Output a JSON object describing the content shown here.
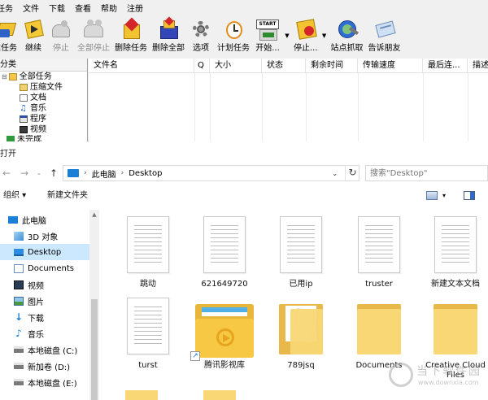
{
  "download_manager": {
    "menu": [
      "任务",
      "文件",
      "下载",
      "查看",
      "帮助",
      "注册"
    ],
    "toolbar": [
      {
        "id": "new",
        "label": "建任务",
        "icon": "new-task-icon",
        "enabled": true
      },
      {
        "id": "resume",
        "label": "继续",
        "icon": "resume-icon",
        "enabled": true
      },
      {
        "id": "stop",
        "label": "停止",
        "icon": "stop-icon",
        "enabled": false
      },
      {
        "id": "stop_all",
        "label": "全部停止",
        "icon": "stop-all-icon",
        "enabled": false
      },
      {
        "id": "delete",
        "label": "删除任务",
        "icon": "delete-task-icon",
        "enabled": true
      },
      {
        "id": "delete_all",
        "label": "删除全部",
        "icon": "delete-all-icon",
        "enabled": true
      },
      {
        "id": "options",
        "label": "选项",
        "icon": "gear-icon",
        "enabled": true
      },
      {
        "id": "scheduler",
        "label": "计划任务",
        "icon": "clock-icon",
        "enabled": true
      },
      {
        "id": "start",
        "label": "开始...",
        "icon": "start-queue-icon",
        "enabled": true
      },
      {
        "id": "stop_q",
        "label": "停止...",
        "icon": "stop-queue-icon",
        "enabled": true
      },
      {
        "id": "grabber",
        "label": "站点抓取",
        "icon": "site-grabber-icon",
        "enabled": true
      },
      {
        "id": "tell",
        "label": "告诉朋友",
        "icon": "tell-friend-icon",
        "enabled": true
      }
    ],
    "start_badge": "START",
    "sidebar_header": "分类",
    "tree": [
      "全部任务",
      "压缩文件",
      "文档",
      "音乐",
      "程序",
      "视频",
      "未完成"
    ],
    "columns": [
      "文件名",
      "Q",
      "大小",
      "状态",
      "剩余时间",
      "传输速度",
      "最后连...",
      "描述"
    ]
  },
  "dialog": {
    "title": "打开",
    "breadcrumb": [
      "此电脑",
      "Desktop"
    ],
    "search_placeholder": "搜索\"Desktop\"",
    "organize": "组织 ▾",
    "new_folder": "新建文件夹",
    "nav": [
      {
        "label": "此电脑",
        "icon": "computer-icon",
        "top": true
      },
      {
        "label": "3D 对象",
        "icon": "cube-icon"
      },
      {
        "label": "Desktop",
        "icon": "desktop-icon",
        "selected": true
      },
      {
        "label": "Documents",
        "icon": "documents-icon"
      },
      {
        "label": "视频",
        "icon": "video-icon"
      },
      {
        "label": "图片",
        "icon": "pictures-icon"
      },
      {
        "label": "下载",
        "icon": "download-icon"
      },
      {
        "label": "音乐",
        "icon": "music-icon"
      },
      {
        "label": "本地磁盘 (C:)",
        "icon": "drive-icon"
      },
      {
        "label": "新加卷 (D:)",
        "icon": "drive-icon"
      },
      {
        "label": "本地磁盘 (E:)",
        "icon": "drive-icon"
      }
    ],
    "files": [
      {
        "name": "跳动",
        "type": "doc"
      },
      {
        "name": "621649720",
        "type": "doc"
      },
      {
        "name": "已用ip",
        "type": "doc"
      },
      {
        "name": "truster",
        "type": "doc"
      },
      {
        "name": "新建文本文档",
        "type": "doc"
      },
      {
        "name": "turst",
        "type": "doc"
      },
      {
        "name": "腾讯影视库",
        "type": "app-folder"
      },
      {
        "name": "789jsq",
        "type": "folder-paper"
      },
      {
        "name": "Documents",
        "type": "folder"
      },
      {
        "name": "Creative Cloud Files",
        "type": "folder"
      }
    ]
  },
  "watermark": {
    "text": "当下软件园",
    "url": "www.downxia.com"
  },
  "colors": {
    "selected": "#cce8ff",
    "folder": "#f8d774",
    "accent": "#1a7fd6"
  }
}
